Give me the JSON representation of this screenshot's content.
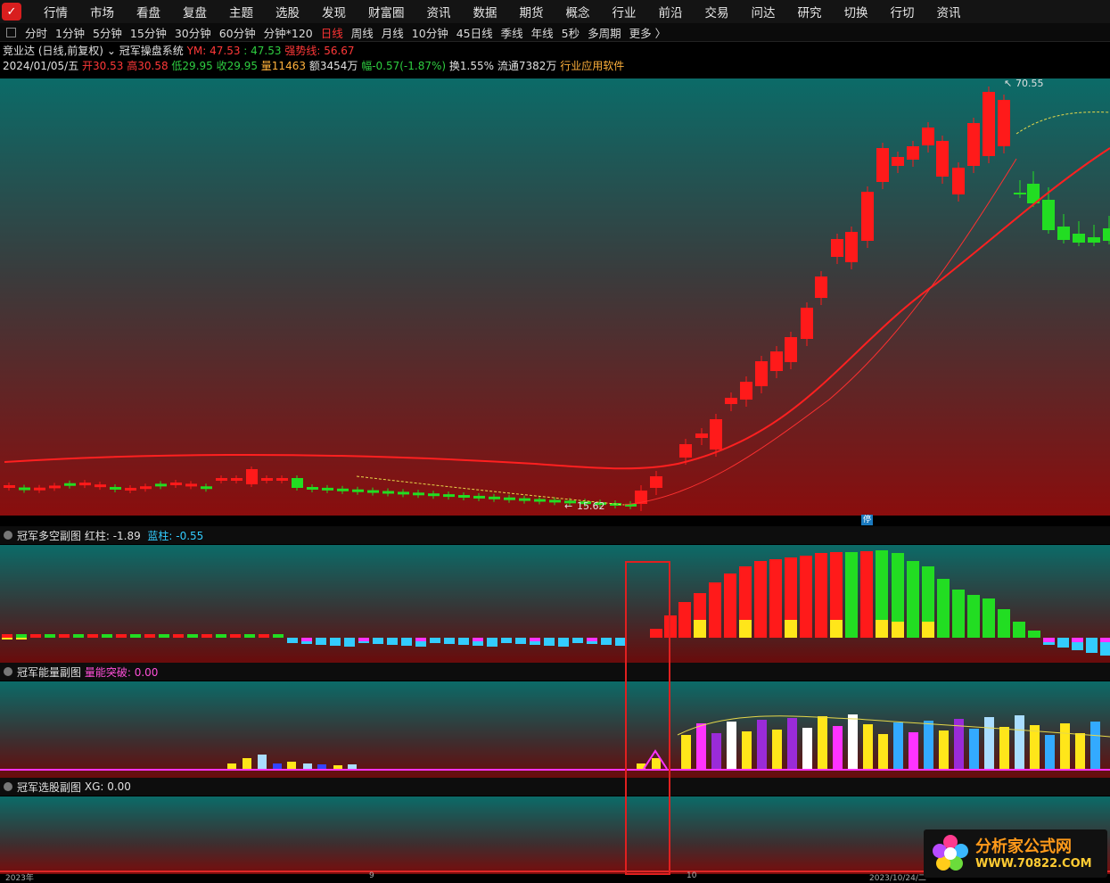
{
  "menu": [
    "行情",
    "市场",
    "看盘",
    "复盘",
    "主题",
    "选股",
    "发现",
    "财富圈",
    "资讯",
    "数据",
    "期货",
    "概念",
    "行业",
    "前沿",
    "交易",
    "问达",
    "研究",
    "切换",
    "行切",
    "资讯"
  ],
  "periods": [
    "分时",
    "1分钟",
    "5分钟",
    "15分钟",
    "30分钟",
    "60分钟",
    "分钟*120",
    "日线",
    "周线",
    "月线",
    "10分钟",
    "45日线",
    "季线",
    "年线",
    "5秒",
    "多周期",
    "更多 〉"
  ],
  "active_period": "日线",
  "info": {
    "stock": "竞业达 (日线,前复权)",
    "system": "冠军操盘系统",
    "ym_label": "YM: 47.53",
    "ym_val": ": 47.53",
    "trend": "强势线: 56.67",
    "date": "2024/01/05/五",
    "open": "开30.53",
    "high": "高30.58",
    "low": "低29.95",
    "close": "收29.95",
    "volume": "量11463",
    "amount": "额3454万",
    "change": "幅-0.57(-1.87%)",
    "turnover": "换1.55%",
    "float": "流通7382万",
    "industry": "行业应用软件"
  },
  "main_chart": {
    "high_label": "70.55",
    "low_label": "15.62",
    "stop_label": "停"
  },
  "panel1": {
    "title": "冠军多空副图",
    "red_label": "红柱: -1.89",
    "blue_label": "蓝柱: -0.55"
  },
  "panel2": {
    "title": "冠军能量副图",
    "energy_label": "量能突破: 0.00"
  },
  "panel3": {
    "title": "冠军选股副图",
    "xg_label": "XG: 0.00"
  },
  "xaxis": {
    "labels": [
      "2023年",
      "9",
      "10",
      "2023/10/24/二"
    ]
  },
  "watermark": {
    "title": "分析家公式网",
    "url": "WWW.70822.COM"
  },
  "colors": {
    "up": "#ff1a1a",
    "down": "#22dd22",
    "cyan": "#33ccff",
    "magenta": "#ff33ff",
    "yellow": "#ffe61a"
  }
}
